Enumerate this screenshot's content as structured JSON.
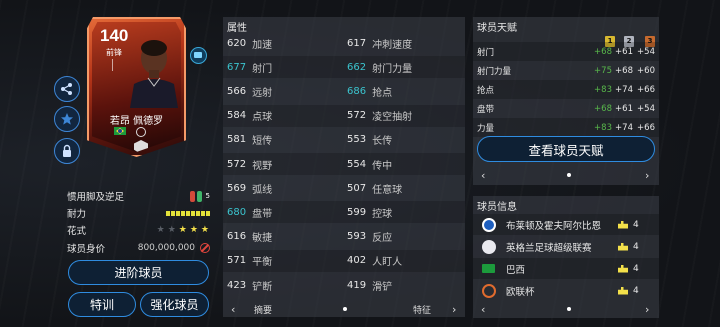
{
  "card": {
    "rating": "140",
    "position": "前锋",
    "name": "若昂 佩德罗"
  },
  "left_info": {
    "foot_label": "惯用脚及逆足",
    "foot_value": "5",
    "stamina_label": "耐力",
    "skills_label": "花式",
    "skills_stars": 3,
    "skills_max": 5,
    "value_label": "球员身价",
    "value": "800,000,000"
  },
  "buttons": {
    "advance": "进阶球员",
    "train": "特训",
    "enhance": "强化球员"
  },
  "attributes": {
    "title": "属性",
    "rows": [
      [
        {
          "num": "620",
          "label": "加速",
          "hi": false
        },
        {
          "num": "617",
          "label": "冲刺速度",
          "hi": false
        }
      ],
      [
        {
          "num": "677",
          "label": "射门",
          "hi": true
        },
        {
          "num": "662",
          "label": "射门力量",
          "hi": true
        }
      ],
      [
        {
          "num": "566",
          "label": "远射",
          "hi": false
        },
        {
          "num": "686",
          "label": "抢点",
          "hi": true
        }
      ],
      [
        {
          "num": "584",
          "label": "点球",
          "hi": false
        },
        {
          "num": "572",
          "label": "凌空抽射",
          "hi": false
        }
      ],
      [
        {
          "num": "581",
          "label": "短传",
          "hi": false
        },
        {
          "num": "553",
          "label": "长传",
          "hi": false
        }
      ],
      [
        {
          "num": "572",
          "label": "视野",
          "hi": false
        },
        {
          "num": "554",
          "label": "传中",
          "hi": false
        }
      ],
      [
        {
          "num": "569",
          "label": "弧线",
          "hi": false
        },
        {
          "num": "507",
          "label": "任意球",
          "hi": false
        }
      ],
      [
        {
          "num": "680",
          "label": "盘带",
          "hi": true
        },
        {
          "num": "599",
          "label": "控球",
          "hi": false
        }
      ],
      [
        {
          "num": "616",
          "label": "敏捷",
          "hi": false
        },
        {
          "num": "593",
          "label": "反应",
          "hi": false
        }
      ],
      [
        {
          "num": "571",
          "label": "平衡",
          "hi": false
        },
        {
          "num": "402",
          "label": "人盯人",
          "hi": false
        }
      ],
      [
        {
          "num": "423",
          "label": "铲断",
          "hi": false
        },
        {
          "num": "419",
          "label": "滑铲",
          "hi": false
        }
      ]
    ],
    "nav_left": "摘要",
    "nav_right": "特征"
  },
  "talent": {
    "title": "球员天赋",
    "ranks": [
      "1",
      "2",
      "3"
    ],
    "rank_colors": [
      "#d8b830",
      "#b0b4be",
      "#c66a2e"
    ],
    "rows": [
      {
        "label": "射门",
        "v1": "+68",
        "v2": "+61",
        "v3": "+54"
      },
      {
        "label": "射门力量",
        "v1": "+75",
        "v2": "+68",
        "v3": "+60"
      },
      {
        "label": "抢点",
        "v1": "+83",
        "v2": "+74",
        "v3": "+66"
      },
      {
        "label": "盘带",
        "v1": "+68",
        "v2": "+61",
        "v3": "+54"
      },
      {
        "label": "力量",
        "v1": "+83",
        "v2": "+74",
        "v3": "+66"
      }
    ],
    "view_button": "查看球员天赋"
  },
  "player_info": {
    "title": "球员信息",
    "rows": [
      {
        "text": "布莱顿及霍夫阿尔比恩",
        "count": "4"
      },
      {
        "text": "英格兰足球超级联赛",
        "count": "4"
      },
      {
        "text": "巴西",
        "count": "4"
      },
      {
        "text": "欧联杯",
        "count": "4"
      }
    ]
  },
  "arrows": {
    "left": "‹",
    "right": "›"
  },
  "colors": {
    "accent_blue": "#2f8ce0",
    "highlight_cyan": "#3bc4ce",
    "talent_green": "#58b84b"
  }
}
